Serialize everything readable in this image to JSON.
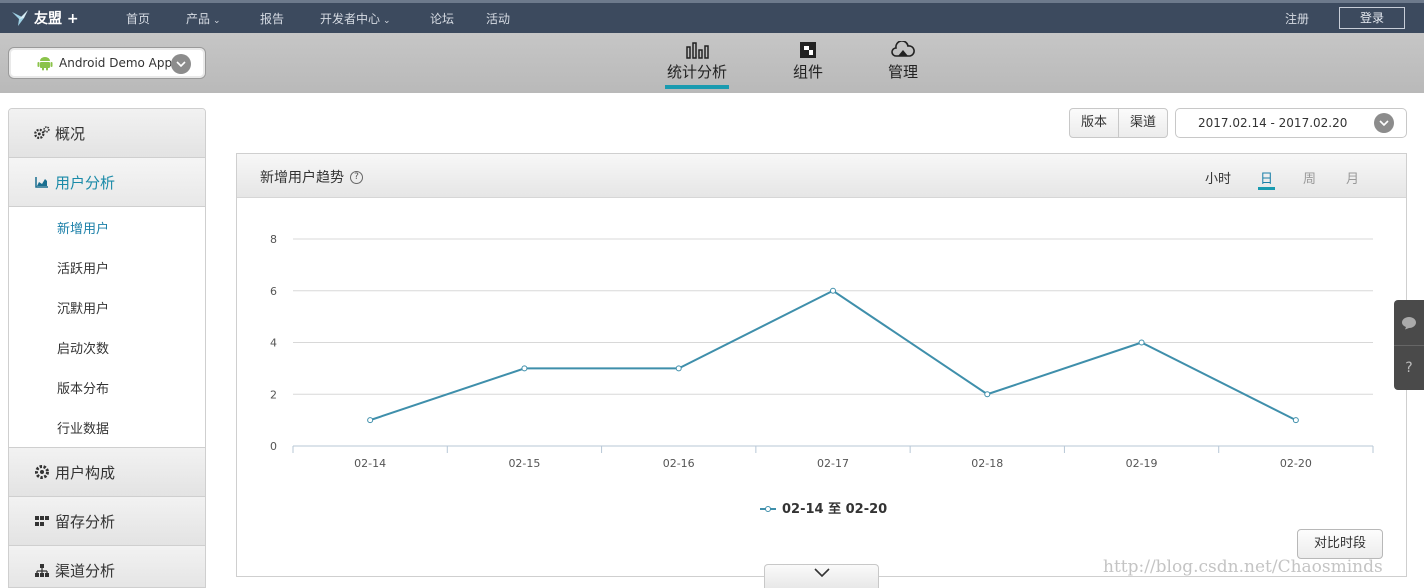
{
  "topbar": {
    "brand": "友盟 +",
    "nav": [
      {
        "label": "首页",
        "dropdown": false
      },
      {
        "label": "产品",
        "dropdown": true
      },
      {
        "label": "报告",
        "dropdown": false
      },
      {
        "label": "开发者中心",
        "dropdown": true
      },
      {
        "label": "论坛",
        "dropdown": false
      },
      {
        "label": "活动",
        "dropdown": false
      }
    ],
    "register": "注册",
    "login": "登录"
  },
  "subbar": {
    "app_name": "Android Demo App",
    "tabs": [
      {
        "label": "统计分析",
        "icon": "bar-chart-icon",
        "active": true
      },
      {
        "label": "组件",
        "icon": "component-icon",
        "active": false
      },
      {
        "label": "管理",
        "icon": "cloud-icon",
        "active": false
      }
    ]
  },
  "sidebar": {
    "sections": [
      {
        "label": "概况",
        "icon": "gears-icon"
      },
      {
        "label": "用户分析",
        "icon": "area-chart-icon",
        "active": true
      },
      {
        "label": "用户构成",
        "icon": "gear-icon"
      },
      {
        "label": "留存分析",
        "icon": "grid-icon"
      },
      {
        "label": "渠道分析",
        "icon": "hierarchy-icon"
      }
    ],
    "sub_items": [
      {
        "label": "新增用户",
        "active": true
      },
      {
        "label": "活跃用户"
      },
      {
        "label": "沉默用户"
      },
      {
        "label": "启动次数"
      },
      {
        "label": "版本分布"
      },
      {
        "label": "行业数据"
      }
    ]
  },
  "filters": {
    "version": "版本",
    "channel": "渠道",
    "date_range": "2017.02.14 - 2017.02.20"
  },
  "panel": {
    "title": "新增用户趋势",
    "help": "?",
    "granularity": [
      {
        "label": "小时",
        "state": "on"
      },
      {
        "label": "日",
        "state": "active"
      },
      {
        "label": "周",
        "state": "off"
      },
      {
        "label": "月",
        "state": "off"
      }
    ],
    "compare_button": "对比时段"
  },
  "chart_data": {
    "type": "line",
    "categories": [
      "02-14",
      "02-15",
      "02-16",
      "02-17",
      "02-18",
      "02-19",
      "02-20"
    ],
    "series": [
      {
        "name": "02-14 至 02-20",
        "values": [
          1,
          3,
          3,
          6,
          2,
          4,
          1
        ],
        "color": "#3f8fab"
      }
    ],
    "ylim": [
      0,
      8
    ],
    "yticks": [
      0,
      2,
      4,
      6,
      8
    ],
    "grid": true,
    "legend": "bottom-center"
  },
  "float_tools": {
    "help": "?"
  },
  "watermark": "http://blog.csdn.net/Chaosminds"
}
